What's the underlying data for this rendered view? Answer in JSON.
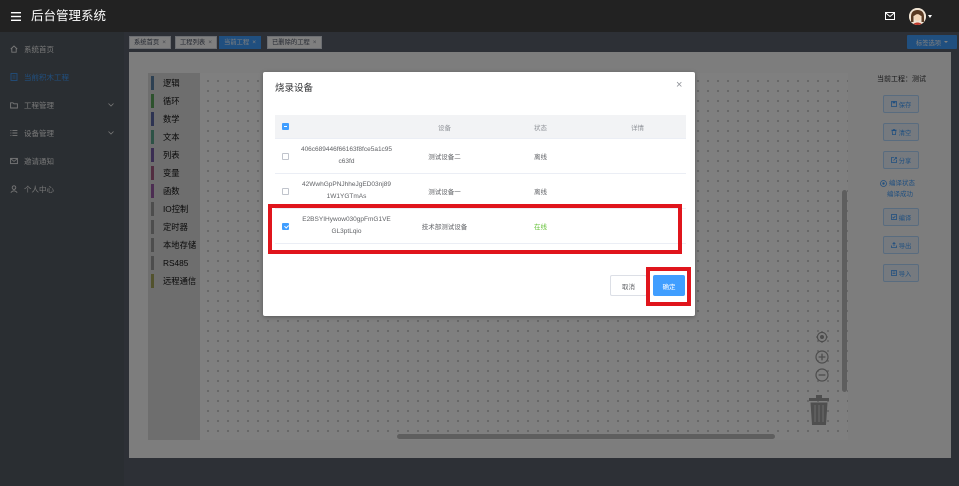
{
  "header": {
    "title": "后台管理系统",
    "icons": [
      "menu-toggle-icon",
      "mail-icon",
      "avatar",
      "caret-down-icon"
    ]
  },
  "sidebar": {
    "items": [
      {
        "label": "系统首页",
        "icon": "home-icon"
      },
      {
        "label": "当前积木工程",
        "icon": "document-icon",
        "active": true
      },
      {
        "label": "工程管理",
        "icon": "folder-icon",
        "expandable": true
      },
      {
        "label": "设备管理",
        "icon": "list-icon",
        "expandable": true
      },
      {
        "label": "邀请通知",
        "icon": "message-icon"
      },
      {
        "label": "个人中心",
        "icon": "user-icon"
      }
    ]
  },
  "tabs": {
    "items": [
      {
        "label": "系统首页"
      },
      {
        "label": "工程列表"
      },
      {
        "label": "当前工程",
        "active": true
      },
      {
        "label": "已删除的工程"
      }
    ],
    "options_label": "标签选项"
  },
  "workspace": {
    "categories": [
      {
        "label": "逻辑",
        "color": "#5b80a5"
      },
      {
        "label": "循环",
        "color": "#5ba55b"
      },
      {
        "label": "数学",
        "color": "#5b67a5"
      },
      {
        "label": "文本",
        "color": "#5ba58c"
      },
      {
        "label": "列表",
        "color": "#745ba5"
      },
      {
        "label": "变量",
        "color": "#a55b80"
      },
      {
        "label": "函数",
        "color": "#995ba5"
      },
      {
        "label": "IO控制",
        "color": "#9a9a9a"
      },
      {
        "label": "定时器",
        "color": "#9a9a9a"
      },
      {
        "label": "本地存储",
        "color": "#9a9a9a"
      },
      {
        "label": "RS485",
        "color": "#9a9a9a"
      },
      {
        "label": "远程通信",
        "color": "#a5a55b"
      }
    ],
    "controls": [
      "target-icon",
      "zoom-in-icon",
      "zoom-out-icon",
      "trash-icon"
    ]
  },
  "project_panel": {
    "current_project": "当前工程：测试",
    "actions": [
      {
        "label": "保存",
        "icon": "save-icon"
      },
      {
        "label": "清空",
        "icon": "delete-icon"
      },
      {
        "label": "分享",
        "icon": "share-icon"
      },
      {
        "label": "编译",
        "icon": "compile-icon"
      },
      {
        "label": "导出",
        "icon": "export-icon"
      },
      {
        "label": "导入",
        "icon": "import-icon"
      }
    ],
    "compile_status_label": "编译状态",
    "compile_status_value": "编译成功"
  },
  "dialog": {
    "title": "烧录设备",
    "columns": {
      "id": "",
      "device": "设备",
      "status": "状态",
      "detail": "详情"
    },
    "select_all_indeterminate": true,
    "rows": [
      {
        "id": "406c689446f66163f8fce5a1c95c63fd",
        "name": "测试设备二",
        "status": "离线",
        "status_color": "#606266",
        "selected": false
      },
      {
        "id": "42WwhGpPNJhheJgED03nj891W1YGTmAs",
        "name": "测试设备一",
        "status": "离线",
        "status_color": "#606266",
        "selected": false
      },
      {
        "id": "E2BSYIHywow030gpFmG1VEGL3ptLqio",
        "name": "技术部测试设备",
        "status": "在线",
        "status_color": "#67c23a",
        "selected": true
      }
    ],
    "cancel_label": "取消",
    "confirm_label": "确定"
  },
  "colors": {
    "primary": "#409eff",
    "online": "#67c23a",
    "highlight": "#e0151c"
  }
}
